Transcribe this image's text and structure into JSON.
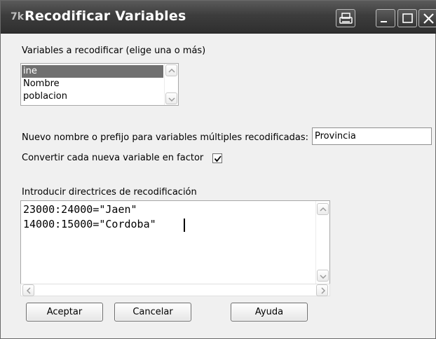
{
  "window": {
    "title": "Recodificar Variables",
    "app_icon_text": "7k"
  },
  "variables": {
    "label": "Variables a recodificar (elige una o más)",
    "items": [
      {
        "label": "ine",
        "selected": true
      },
      {
        "label": "Nombre",
        "selected": false
      },
      {
        "label": "poblacion",
        "selected": false
      }
    ]
  },
  "new_name": {
    "label": "Nuevo nombre o prefijo para variables múltiples recodificadas:",
    "value": "Provincia"
  },
  "factor": {
    "label": "Convertir cada nueva variable en factor",
    "checked": true
  },
  "directives": {
    "label": "Introducir directrices de recodificación",
    "lines": [
      "23000:24000=\"Jaen\"",
      "14000:15000=\"Cordoba\""
    ]
  },
  "buttons": {
    "accept": "Aceptar",
    "cancel": "Cancelar",
    "help": "Ayuda"
  },
  "icons": {
    "print": "printer-icon",
    "minimize": "minimize-icon",
    "maximize": "maximize-icon",
    "close": "close-icon"
  },
  "colors": {
    "titlebar": "#3d3d3d",
    "selection": "#707070"
  }
}
